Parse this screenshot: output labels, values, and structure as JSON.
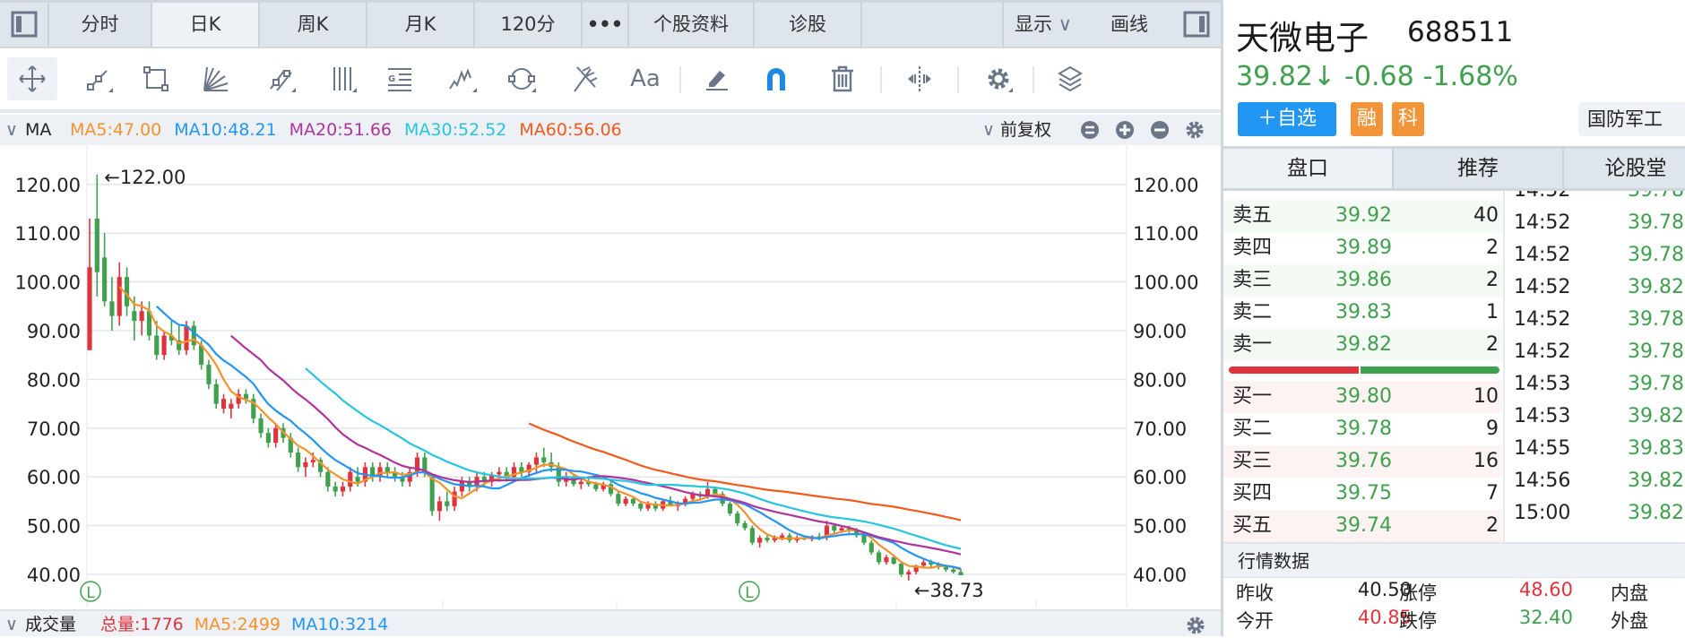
{
  "tabs": [
    {
      "label": "分时"
    },
    {
      "label": "日K",
      "active": true
    },
    {
      "label": "周K"
    },
    {
      "label": "月K"
    },
    {
      "label": "120分"
    },
    {
      "label": "•••"
    },
    {
      "label": "个股资料"
    },
    {
      "label": "诊股"
    }
  ],
  "topright": {
    "display": "显示",
    "draw": "画线"
  },
  "toolbar_icons": [
    "move-icon",
    "line-segment-icon",
    "rectangle-icon",
    "fan-lines-icon",
    "parallel-channel-icon",
    "vertical-lines-icon",
    "gann-icon",
    "wave-icon",
    "ellipse-icon",
    "pitchfork-icon",
    "text-icon",
    "eraser-icon",
    "magnet-icon",
    "trash-icon",
    "scale-icon",
    "settings-icon",
    "layers-icon"
  ],
  "text_tool_label": "Aa",
  "ma_bar": {
    "label": "MA",
    "items": [
      {
        "text": "MA5:47.00",
        "color": "#f4922e"
      },
      {
        "text": "MA10:48.21",
        "color": "#2196f3"
      },
      {
        "text": "MA20:51.66",
        "color": "#b0349b"
      },
      {
        "text": "MA30:52.52",
        "color": "#25c6de"
      },
      {
        "text": "MA60:56.06",
        "color": "#f25a1a"
      }
    ],
    "adjust": "前复权"
  },
  "vol_bar": {
    "label": "成交量",
    "items": [
      {
        "text": "总量:1776",
        "color": "#e0343c"
      },
      {
        "text": "MA5:2499",
        "color": "#f4922e"
      },
      {
        "text": "MA10:3214",
        "color": "#2196f3"
      }
    ]
  },
  "stock": {
    "name": "天微电子",
    "code": "688511",
    "price": "39.82↓",
    "change": "-0.68",
    "pct": "-1.68%",
    "add_watch": "＋自选",
    "tag1": "融",
    "tag2": "科",
    "sector": "国防军工"
  },
  "panel_tabs": [
    "盘口",
    "推荐",
    "论股堂"
  ],
  "sell": [
    {
      "n": "卖五",
      "p": "39.92",
      "v": "40"
    },
    {
      "n": "卖四",
      "p": "39.89",
      "v": "2"
    },
    {
      "n": "卖三",
      "p": "39.86",
      "v": "2"
    },
    {
      "n": "卖二",
      "p": "39.83",
      "v": "1"
    },
    {
      "n": "卖一",
      "p": "39.82",
      "v": "2"
    }
  ],
  "buy": [
    {
      "n": "买一",
      "p": "39.80",
      "v": "10"
    },
    {
      "n": "买二",
      "p": "39.78",
      "v": "9"
    },
    {
      "n": "买三",
      "p": "39.76",
      "v": "16"
    },
    {
      "n": "买四",
      "p": "39.75",
      "v": "7"
    },
    {
      "n": "买五",
      "p": "39.74",
      "v": "2"
    }
  ],
  "bid_ask_ratio": 0.48,
  "ticks": [
    {
      "t": "14:52",
      "p": "39.78"
    },
    {
      "t": "14:52",
      "p": "39.78"
    },
    {
      "t": "14:52",
      "p": "39.78"
    },
    {
      "t": "14:52",
      "p": "39.82"
    },
    {
      "t": "14:52",
      "p": "39.78"
    },
    {
      "t": "14:52",
      "p": "39.78"
    },
    {
      "t": "14:53",
      "p": "39.78"
    },
    {
      "t": "14:53",
      "p": "39.82"
    },
    {
      "t": "14:55",
      "p": "39.83"
    },
    {
      "t": "14:56",
      "p": "39.82"
    },
    {
      "t": "15:00",
      "p": "39.82"
    }
  ],
  "quote_data": {
    "title": "行情数据",
    "rows": [
      [
        {
          "l": "昨收",
          "v": "40.50",
          "c": "#222"
        },
        {
          "l": "涨停",
          "v": "48.60",
          "c": "#e0343c"
        },
        {
          "l": "内盘"
        }
      ],
      [
        {
          "l": "今开",
          "v": "40.85",
          "c": "#e0343c"
        },
        {
          "l": "跌停",
          "v": "32.40",
          "c": "#3fa14e"
        },
        {
          "l": "外盘"
        }
      ]
    ]
  },
  "colors": {
    "up": "#e0343c",
    "down": "#3fa14e",
    "accent": "#2196f3",
    "tag": "#f2953a"
  },
  "chart_data": {
    "type": "candlestick",
    "ylim": [
      35,
      125
    ],
    "yticks": [
      "120.00",
      "110.00",
      "100.00",
      "90.00",
      "80.00",
      "70.00",
      "60.00",
      "50.00",
      "40.00"
    ],
    "high_label": "←122.00",
    "low_label": "←38.73",
    "marker": "L",
    "ma_periods": [
      5,
      10,
      20,
      30,
      60
    ],
    "candles": [
      [
        86,
        113,
        86,
        103
      ],
      [
        113,
        122,
        97,
        102
      ],
      [
        105,
        110,
        95,
        96
      ],
      [
        96,
        101,
        90,
        93
      ],
      [
        93,
        104,
        91,
        101
      ],
      [
        101,
        103,
        93,
        95
      ],
      [
        94,
        97,
        88,
        92
      ],
      [
        92,
        96,
        89,
        94
      ],
      [
        94,
        96,
        88,
        89
      ],
      [
        89,
        92,
        84,
        85
      ],
      [
        85,
        90,
        84,
        89
      ],
      [
        89,
        92,
        87,
        88
      ],
      [
        88,
        91,
        85,
        86
      ],
      [
        86,
        92,
        85,
        91
      ],
      [
        91,
        92,
        86,
        87
      ],
      [
        87,
        88,
        82,
        83
      ],
      [
        83,
        84,
        78,
        79
      ],
      [
        79,
        80,
        74,
        75
      ],
      [
        74,
        77,
        73,
        76
      ],
      [
        74,
        76,
        72,
        75
      ],
      [
        75,
        78,
        74,
        77
      ],
      [
        77,
        78,
        75,
        76
      ],
      [
        76,
        77,
        71,
        72
      ],
      [
        72,
        73,
        68,
        69
      ],
      [
        69,
        70,
        66,
        67
      ],
      [
        67,
        71,
        66,
        70
      ],
      [
        70,
        71,
        67,
        68
      ],
      [
        68,
        69,
        64,
        65
      ],
      [
        65,
        66,
        61,
        62
      ],
      [
        62,
        64,
        60,
        63
      ],
      [
        63,
        65,
        62,
        63.5
      ],
      [
        63.5,
        64,
        60,
        61
      ],
      [
        61,
        62,
        57,
        58
      ],
      [
        58,
        59,
        56,
        57
      ],
      [
        57,
        59,
        56,
        58
      ],
      [
        58,
        62,
        57,
        61
      ],
      [
        60,
        62,
        58,
        59
      ],
      [
        59,
        63,
        58,
        62
      ],
      [
        62,
        63,
        59,
        60
      ],
      [
        60,
        63,
        59,
        62
      ],
      [
        62,
        63,
        60,
        61
      ],
      [
        61,
        62,
        59,
        60
      ],
      [
        60,
        61,
        58,
        59
      ],
      [
        59,
        62,
        58,
        61
      ],
      [
        61,
        65,
        60,
        64
      ],
      [
        64,
        65,
        60,
        61
      ],
      [
        60,
        60,
        52,
        53
      ],
      [
        53,
        56,
        51,
        55
      ],
      [
        55,
        57,
        53,
        54
      ],
      [
        54,
        58,
        53,
        57
      ],
      [
        57,
        60,
        56,
        59
      ],
      [
        59,
        60,
        57,
        58
      ],
      [
        58,
        61,
        57,
        60
      ],
      [
        60,
        61,
        58,
        59
      ],
      [
        59,
        61,
        58,
        60.5
      ],
      [
        60.5,
        62,
        59,
        61
      ],
      [
        61,
        62,
        59,
        60
      ],
      [
        60,
        63,
        59,
        62
      ],
      [
        62,
        63,
        60,
        61
      ],
      [
        61,
        63,
        60,
        62.5
      ],
      [
        62.5,
        65,
        61,
        64
      ],
      [
        64,
        66,
        62,
        63
      ],
      [
        63,
        65,
        61,
        62
      ],
      [
        62,
        63,
        58,
        59
      ],
      [
        59,
        61,
        58,
        60
      ],
      [
        60,
        60.5,
        58,
        58.5
      ],
      [
        58.5,
        60,
        57.5,
        59
      ],
      [
        59,
        60,
        58,
        58.5
      ],
      [
        58.5,
        59,
        57,
        57.5
      ],
      [
        57.5,
        59,
        57,
        58.5
      ],
      [
        58.5,
        59,
        56,
        56.5
      ],
      [
        56.5,
        57,
        54,
        54.5
      ],
      [
        54.5,
        56,
        54,
        55.5
      ],
      [
        55.5,
        56,
        54,
        54.5
      ],
      [
        54.5,
        55,
        53,
        53.5
      ],
      [
        53.5,
        55,
        53,
        54.5
      ],
      [
        54.5,
        55,
        53,
        53.5
      ],
      [
        53.5,
        55.5,
        53,
        55
      ],
      [
        55,
        56,
        54,
        54
      ],
      [
        54,
        55,
        53,
        54.5
      ],
      [
        54.5,
        56,
        54,
        55.5
      ],
      [
        55.5,
        57,
        55,
        56.5
      ],
      [
        56.5,
        57,
        55.5,
        56
      ],
      [
        56,
        59,
        55.5,
        57.5
      ],
      [
        57.5,
        58,
        56,
        56.5
      ],
      [
        56.5,
        57,
        54,
        54.5
      ],
      [
        54.5,
        55,
        52,
        52.5
      ],
      [
        52.5,
        53,
        50,
        50.5
      ],
      [
        50.5,
        51,
        49,
        49.5
      ],
      [
        49.5,
        50,
        46,
        46.5
      ],
      [
        46.5,
        48,
        45.5,
        47.5
      ],
      [
        47.5,
        48,
        46.5,
        47
      ],
      [
        47,
        48,
        46.5,
        47.5
      ],
      [
        47.5,
        48.5,
        47,
        48
      ],
      [
        48,
        48.5,
        46.5,
        47
      ],
      [
        47,
        48,
        46.5,
        47.5
      ],
      [
        47.5,
        48,
        47,
        47.2
      ],
      [
        47.2,
        48,
        46.8,
        47.8
      ],
      [
        47.8,
        48.5,
        47,
        47.5
      ],
      [
        47.5,
        51,
        47,
        50
      ],
      [
        50,
        50.5,
        48.5,
        49
      ],
      [
        49,
        50,
        48.5,
        49.5
      ],
      [
        49.5,
        50,
        48.5,
        49
      ],
      [
        49,
        49.5,
        47.5,
        48
      ],
      [
        48,
        48.5,
        46,
        46.5
      ],
      [
        46.5,
        47,
        44,
        44.5
      ],
      [
        44.5,
        45,
        42,
        42.5
      ],
      [
        42.5,
        44,
        42,
        43.5
      ],
      [
        43.5,
        44,
        42,
        42.2
      ],
      [
        42.2,
        42.5,
        39.5,
        40
      ],
      [
        40,
        41,
        38.73,
        40.5
      ],
      [
        40.5,
        42,
        40,
        41.8
      ],
      [
        41.8,
        43,
        41.5,
        42.5
      ],
      [
        42.5,
        43,
        41.5,
        42
      ],
      [
        42,
        42.5,
        41,
        41.5
      ],
      [
        41.5,
        42,
        40.5,
        41
      ],
      [
        41,
        41.5,
        40.2,
        40.5
      ],
      [
        40.5,
        41.2,
        39.8,
        39.82
      ]
    ]
  }
}
